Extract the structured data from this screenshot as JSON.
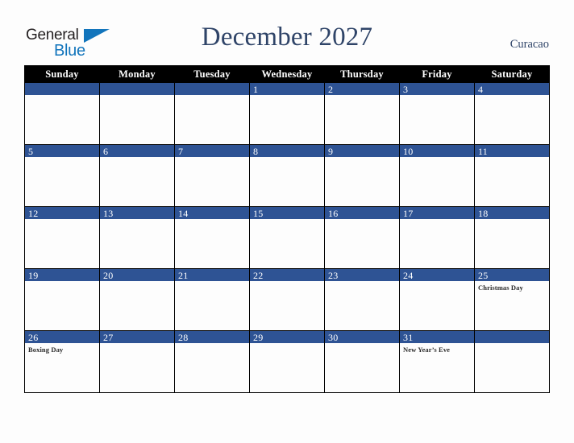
{
  "brand": {
    "name_part1": "General",
    "name_part2": "Blue",
    "logo_icon": "triangle-icon",
    "color_blue": "#1275bc",
    "color_dark": "#231f20"
  },
  "header": {
    "title": "December 2027",
    "location": "Curacao",
    "title_color": "#2f4468"
  },
  "calendar": {
    "month": "December",
    "year": "2027",
    "weekday_headers": [
      "Sunday",
      "Monday",
      "Tuesday",
      "Wednesday",
      "Thursday",
      "Friday",
      "Saturday"
    ],
    "header_bg": "#000000",
    "daybar_bg": "#2e5394",
    "weeks": [
      [
        {
          "day": "",
          "event": ""
        },
        {
          "day": "",
          "event": ""
        },
        {
          "day": "",
          "event": ""
        },
        {
          "day": "1",
          "event": ""
        },
        {
          "day": "2",
          "event": ""
        },
        {
          "day": "3",
          "event": ""
        },
        {
          "day": "4",
          "event": ""
        }
      ],
      [
        {
          "day": "5",
          "event": ""
        },
        {
          "day": "6",
          "event": ""
        },
        {
          "day": "7",
          "event": ""
        },
        {
          "day": "8",
          "event": ""
        },
        {
          "day": "9",
          "event": ""
        },
        {
          "day": "10",
          "event": ""
        },
        {
          "day": "11",
          "event": ""
        }
      ],
      [
        {
          "day": "12",
          "event": ""
        },
        {
          "day": "13",
          "event": ""
        },
        {
          "day": "14",
          "event": ""
        },
        {
          "day": "15",
          "event": ""
        },
        {
          "day": "16",
          "event": ""
        },
        {
          "day": "17",
          "event": ""
        },
        {
          "day": "18",
          "event": ""
        }
      ],
      [
        {
          "day": "19",
          "event": ""
        },
        {
          "day": "20",
          "event": ""
        },
        {
          "day": "21",
          "event": ""
        },
        {
          "day": "22",
          "event": ""
        },
        {
          "day": "23",
          "event": ""
        },
        {
          "day": "24",
          "event": ""
        },
        {
          "day": "25",
          "event": "Christmas Day"
        }
      ],
      [
        {
          "day": "26",
          "event": "Boxing Day"
        },
        {
          "day": "27",
          "event": ""
        },
        {
          "day": "28",
          "event": ""
        },
        {
          "day": "29",
          "event": ""
        },
        {
          "day": "30",
          "event": ""
        },
        {
          "day": "31",
          "event": "New Year’s Eve"
        },
        {
          "day": "",
          "event": ""
        }
      ]
    ]
  }
}
